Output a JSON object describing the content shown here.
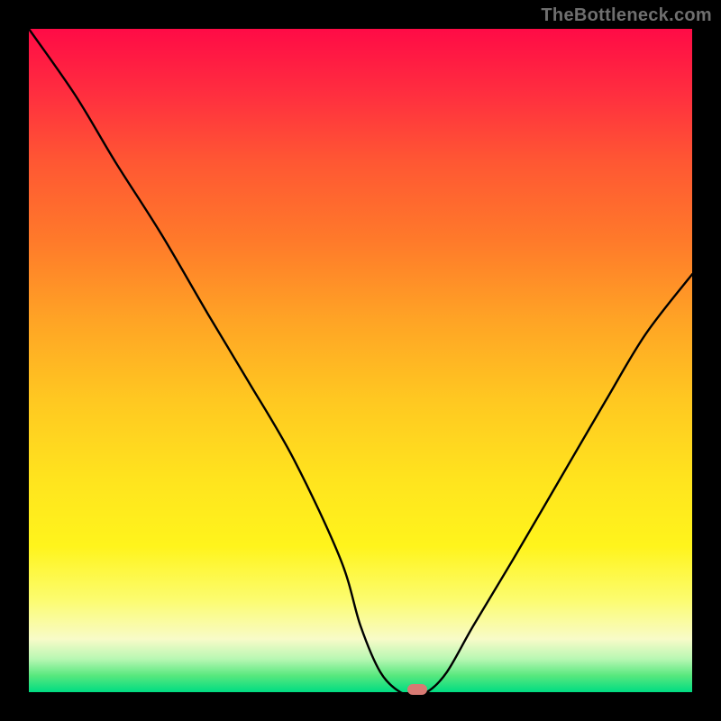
{
  "watermark": "TheBottleneck.com",
  "colors": {
    "frame": "#000000",
    "curve": "#000000",
    "marker": "#d87a73",
    "gradient_top": "#ff0b46",
    "gradient_bottom": "#00dc82"
  },
  "chart_data": {
    "type": "line",
    "title": "",
    "xlabel": "",
    "ylabel": "",
    "xlim": [
      0,
      100
    ],
    "ylim": [
      0,
      100
    ],
    "grid": false,
    "annotations": [
      {
        "text": "TheBottleneck.com",
        "position": "top-right"
      }
    ],
    "series": [
      {
        "name": "bottleneck-curve",
        "x": [
          0,
          7,
          13,
          20,
          27,
          33,
          40,
          47,
          50,
          53,
          56,
          58,
          60,
          63,
          67,
          73,
          80,
          87,
          93,
          100
        ],
        "values": [
          100,
          90,
          80,
          69,
          57,
          47,
          35,
          20,
          10,
          3,
          0,
          0,
          0,
          3,
          10,
          20,
          32,
          44,
          54,
          63
        ]
      }
    ],
    "marker": {
      "x": 58.5,
      "y": 0
    }
  }
}
